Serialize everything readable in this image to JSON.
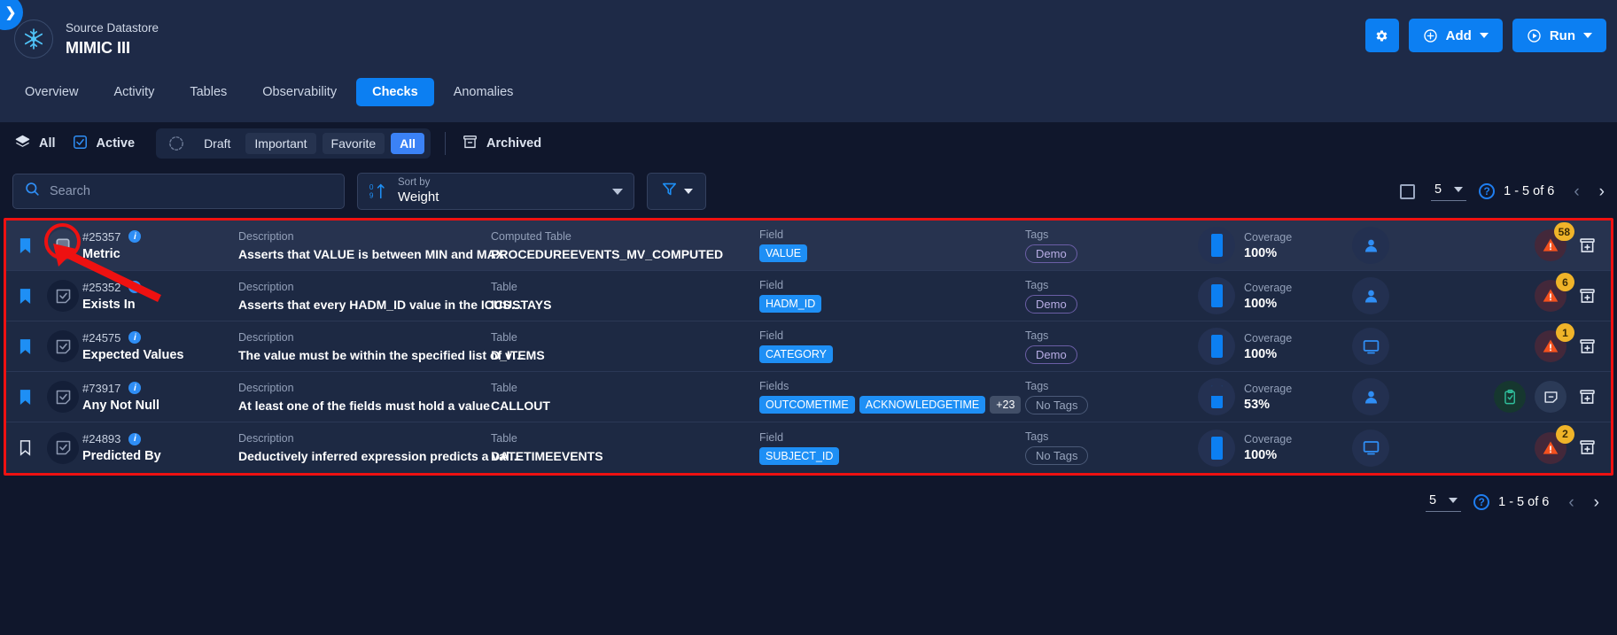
{
  "header": {
    "collapse_icon": "chevron-right-icon",
    "datastore_label": "Source Datastore",
    "datastore_name": "MIMIC III",
    "logo_icon": "snowflake-icon",
    "actions": {
      "settings_icon": "gear-icon",
      "add_label": "Add",
      "add_icon": "plus-circle-icon",
      "run_label": "Run",
      "run_icon": "play-circle-icon",
      "chevron_icon": "chevron-down-icon"
    }
  },
  "tabs": [
    {
      "label": "Overview",
      "active": false
    },
    {
      "label": "Activity",
      "active": false
    },
    {
      "label": "Tables",
      "active": false
    },
    {
      "label": "Observability",
      "active": false
    },
    {
      "label": "Checks",
      "active": true
    },
    {
      "label": "Anomalies",
      "active": false
    }
  ],
  "filters": {
    "all_label": "All",
    "all_icon": "layers-icon",
    "active_label": "Active",
    "active_icon": "checkbox-checked-icon",
    "state_icon": "circle-check-dashed-icon",
    "segments": [
      {
        "label": "Draft",
        "active": false,
        "plain": true
      },
      {
        "label": "Important",
        "active": false,
        "plain": false
      },
      {
        "label": "Favorite",
        "active": false,
        "plain": false
      },
      {
        "label": "All",
        "active": true,
        "plain": false
      }
    ],
    "archived_label": "Archived",
    "archived_icon": "archive-box-icon"
  },
  "search": {
    "placeholder": "Search",
    "value": "",
    "icon": "search-icon"
  },
  "sort": {
    "icon": "sort-ascending-09-icon",
    "label": "Sort by",
    "value": "Weight",
    "dropdown_icon": "chevron-down-icon"
  },
  "filter_button": {
    "icon": "funnel-icon",
    "dropdown_icon": "chevron-down-icon"
  },
  "pagination_top": {
    "select_all_icon": "checkbox-empty-icon",
    "page_size": "5",
    "page_size_dropdown_icon": "chevron-down-icon",
    "help_icon": "question-circle-icon",
    "help_label": "?",
    "range": "1 - 5 of 6",
    "prev_icon": "chevron-left-icon",
    "next_icon": "chevron-right-icon",
    "prev_glyph": "‹",
    "next_glyph": "›"
  },
  "pagination_bottom": {
    "page_size": "5",
    "page_size_dropdown_icon": "chevron-down-icon",
    "help_icon": "question-circle-icon",
    "help_label": "?",
    "range": "1 - 5 of 6",
    "prev_glyph": "‹",
    "next_glyph": "›"
  },
  "rows": [
    {
      "bookmarked": true,
      "selected": true,
      "type_icon": "square-outline-icon",
      "id": "#25357",
      "name": "Metric",
      "desc_label": "Description",
      "desc_value": "Asserts that VALUE is between MIN and MAX",
      "table_label": "Computed Table",
      "table_value": "PROCEDUREEVENTS_MV_COMPUTED",
      "field_label": "Field",
      "fields": [
        "VALUE"
      ],
      "more_fields": "",
      "tags_label": "Tags",
      "tag": "Demo",
      "tag_none": false,
      "coverage_label": "Coverage",
      "coverage_value": "100%",
      "coverage_pct": 100,
      "source_icon": "user-icon",
      "has_clipboard": false,
      "has_comment": false,
      "warn_count": "58",
      "has_warn": true,
      "archive_icon": "archive-add-icon"
    },
    {
      "bookmarked": true,
      "selected": false,
      "type_icon": "note-check-icon",
      "id": "#25352",
      "name": "Exists In",
      "desc_label": "Description",
      "desc_value": "Asserts that every HADM_ID value in the ICUS…",
      "table_label": "Table",
      "table_value": "ICUSTAYS",
      "field_label": "Field",
      "fields": [
        "HADM_ID"
      ],
      "more_fields": "",
      "tags_label": "Tags",
      "tag": "Demo",
      "tag_none": false,
      "coverage_label": "Coverage",
      "coverage_value": "100%",
      "coverage_pct": 100,
      "source_icon": "user-icon",
      "has_clipboard": false,
      "has_comment": false,
      "warn_count": "6",
      "has_warn": true,
      "archive_icon": "archive-add-icon"
    },
    {
      "bookmarked": true,
      "selected": false,
      "type_icon": "note-check-icon",
      "id": "#24575",
      "name": "Expected Values",
      "desc_label": "Description",
      "desc_value": "The value must be within the specified list of v…",
      "table_label": "Table",
      "table_value": "D_ITEMS",
      "field_label": "Field",
      "fields": [
        "CATEGORY"
      ],
      "more_fields": "",
      "tags_label": "Tags",
      "tag": "Demo",
      "tag_none": false,
      "coverage_label": "Coverage",
      "coverage_value": "100%",
      "coverage_pct": 100,
      "source_icon": "monitor-icon",
      "has_clipboard": false,
      "has_comment": false,
      "warn_count": "1",
      "has_warn": true,
      "archive_icon": "archive-add-icon"
    },
    {
      "bookmarked": true,
      "selected": false,
      "type_icon": "note-check-icon",
      "id": "#73917",
      "name": "Any Not Null",
      "desc_label": "Description",
      "desc_value": "At least one of the fields must hold a value",
      "table_label": "Table",
      "table_value": "CALLOUT",
      "field_label": "Fields",
      "fields": [
        "OUTCOMETIME",
        "ACKNOWLEDGETIME"
      ],
      "more_fields": "+23",
      "tags_label": "Tags",
      "tag": "No Tags",
      "tag_none": true,
      "coverage_label": "Coverage",
      "coverage_value": "53%",
      "coverage_pct": 53,
      "source_icon": "user-icon",
      "has_clipboard": true,
      "has_comment": true,
      "warn_count": "",
      "has_warn": false,
      "archive_icon": "archive-add-icon"
    },
    {
      "bookmarked": false,
      "selected": false,
      "type_icon": "note-check-icon",
      "id": "#24893",
      "name": "Predicted By",
      "desc_label": "Description",
      "desc_value": "Deductively inferred expression predicts a val…",
      "table_label": "Table",
      "table_value": "DATETIMEEVENTS",
      "field_label": "Field",
      "fields": [
        "SUBJECT_ID"
      ],
      "more_fields": "",
      "tags_label": "Tags",
      "tag": "No Tags",
      "tag_none": true,
      "coverage_label": "Coverage",
      "coverage_value": "100%",
      "coverage_pct": 100,
      "source_icon": "monitor-icon",
      "has_clipboard": false,
      "has_comment": false,
      "warn_count": "2",
      "has_warn": true,
      "archive_icon": "archive-add-icon"
    }
  ],
  "colors": {
    "accent": "#0c7ff2",
    "annotation": "#ee1111",
    "warn": "#f0b429",
    "tag": "#b9aee6",
    "panel": "#1d2943",
    "background": "#10172c"
  }
}
